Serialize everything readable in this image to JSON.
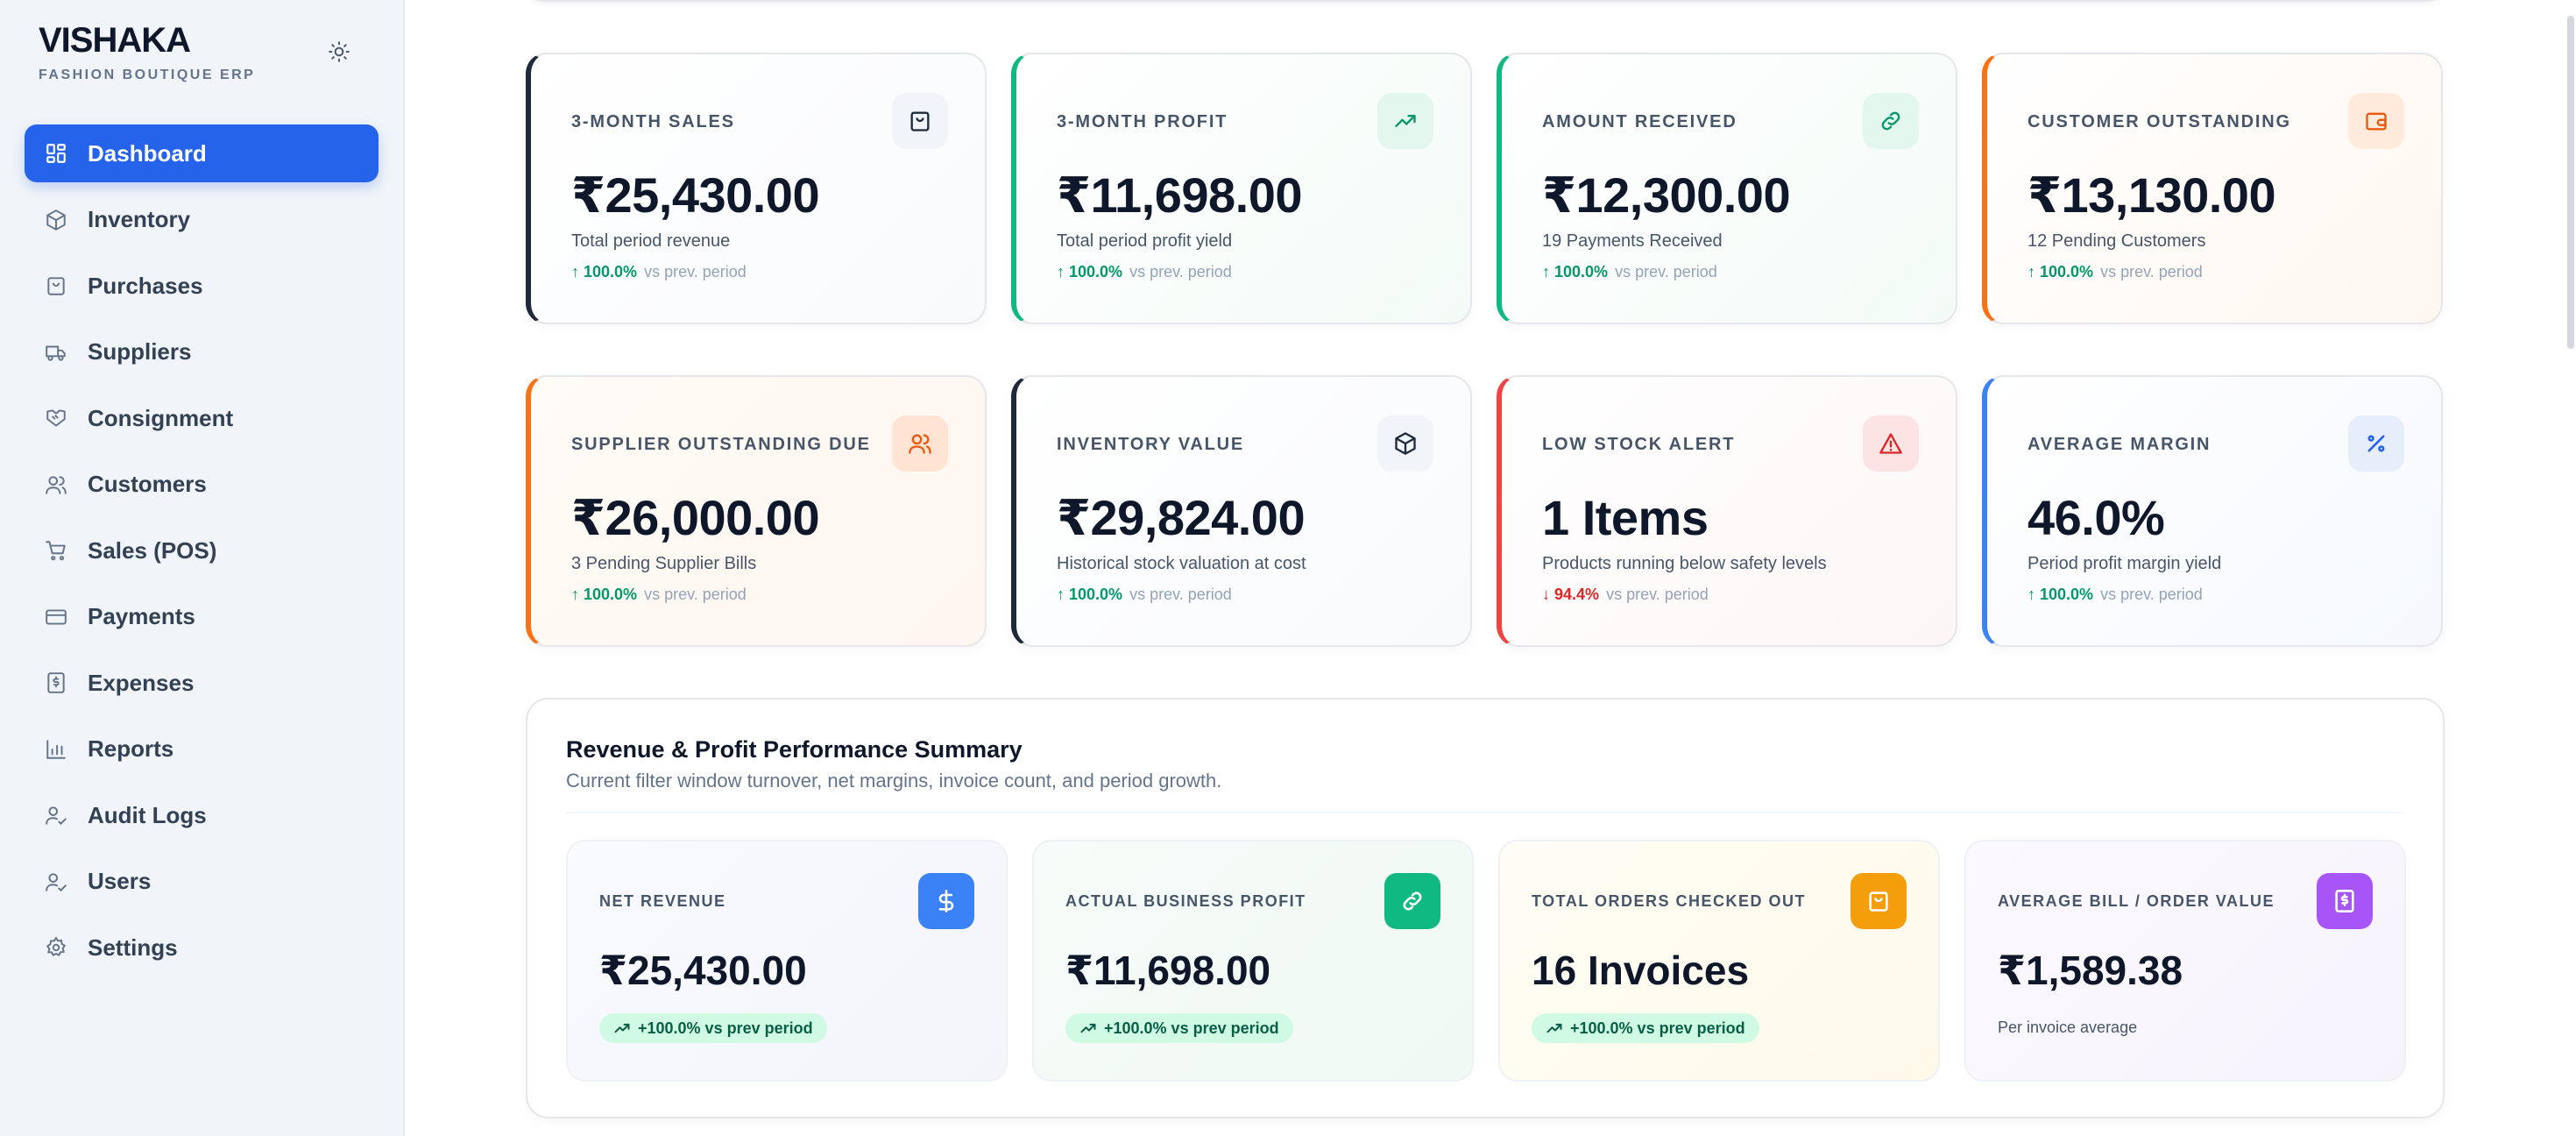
{
  "sidebar": {
    "brand_name": "VISHAKA",
    "brand_subtitle": "FASHION BOUTIQUE ERP",
    "theme_icon": "sun-icon",
    "items": [
      {
        "label": "Dashboard",
        "icon": "dashboard-icon",
        "active": true
      },
      {
        "label": "Inventory",
        "icon": "box-icon"
      },
      {
        "label": "Purchases",
        "icon": "shopping-bag-icon"
      },
      {
        "label": "Suppliers",
        "icon": "truck-icon"
      },
      {
        "label": "Consignment",
        "icon": "handshake-icon"
      },
      {
        "label": "Customers",
        "icon": "users-icon"
      },
      {
        "label": "Sales (POS)",
        "icon": "cart-icon"
      },
      {
        "label": "Payments",
        "icon": "credit-card-icon"
      },
      {
        "label": "Expenses",
        "icon": "receipt-icon"
      },
      {
        "label": "Reports",
        "icon": "bar-chart-icon"
      },
      {
        "label": "Audit Logs",
        "icon": "user-check-icon"
      },
      {
        "label": "Users",
        "icon": "user-check-icon"
      },
      {
        "label": "Settings",
        "icon": "gear-icon"
      }
    ]
  },
  "kpis": [
    {
      "title": "3-MONTH SALES",
      "value": "₹25,430.00",
      "subtitle": "Total period revenue",
      "change": "100.0%",
      "direction": "up",
      "compare": "vs prev. period",
      "icon": "shopping-bag-icon",
      "accent": "#1e293b"
    },
    {
      "title": "3-MONTH PROFIT",
      "value": "₹11,698.00",
      "subtitle": "Total period profit yield",
      "change": "100.0%",
      "direction": "up",
      "compare": "vs prev. period",
      "icon": "trending-up-icon",
      "accent": "#10b981"
    },
    {
      "title": "AMOUNT RECEIVED",
      "value": "₹12,300.00",
      "subtitle": "19 Payments Received",
      "change": "100.0%",
      "direction": "up",
      "compare": "vs prev. period",
      "icon": "link-icon",
      "accent": "#10b981"
    },
    {
      "title": "CUSTOMER OUTSTANDING",
      "value": "₹13,130.00",
      "subtitle": "12 Pending Customers",
      "change": "100.0%",
      "direction": "up",
      "compare": "vs prev. period",
      "icon": "wallet-icon",
      "accent": "#f97316"
    },
    {
      "title": "SUPPLIER OUTSTANDING DUE",
      "value": "₹26,000.00",
      "subtitle": "3 Pending Supplier Bills",
      "change": "100.0%",
      "direction": "up",
      "compare": "vs prev. period",
      "icon": "users-icon",
      "accent": "#f97316"
    },
    {
      "title": "INVENTORY VALUE",
      "value": "₹29,824.00",
      "subtitle": "Historical stock valuation at cost",
      "change": "100.0%",
      "direction": "up",
      "compare": "vs prev. period",
      "icon": "box-icon",
      "accent": "#1e293b"
    },
    {
      "title": "LOW STOCK ALERT",
      "value": "1 Items",
      "subtitle": "Products running below safety levels",
      "change": "94.4%",
      "direction": "down",
      "compare": "vs prev. period",
      "icon": "alert-triangle-icon",
      "accent": "#ef4444"
    },
    {
      "title": "AVERAGE MARGIN",
      "value": "46.0%",
      "subtitle": "Period profit margin yield",
      "change": "100.0%",
      "direction": "up",
      "compare": "vs prev. period",
      "icon": "percent-icon",
      "accent": "#3b82f6"
    }
  ],
  "summary": {
    "title": "Revenue & Profit Performance Summary",
    "subtitle": "Current filter window turnover, net margins, invoice count, and period growth.",
    "cards": [
      {
        "title": "NET REVENUE",
        "value": "₹25,430.00",
        "badge": "+100.0% vs prev period",
        "icon": "dollar-icon",
        "color": "#3b82f6"
      },
      {
        "title": "ACTUAL BUSINESS PROFIT",
        "value": "₹11,698.00",
        "badge": "+100.0% vs prev period",
        "icon": "link-icon",
        "color": "#10b981"
      },
      {
        "title": "TOTAL ORDERS CHECKED OUT",
        "value": "16 Invoices",
        "badge": "+100.0% vs prev period",
        "icon": "shopping-bag-icon",
        "color": "#f59e0b"
      },
      {
        "title": "AVERAGE BILL / ORDER VALUE",
        "value": "₹1,589.38",
        "note": "Per invoice average",
        "icon": "receipt-icon",
        "color": "#a855f7"
      }
    ]
  }
}
